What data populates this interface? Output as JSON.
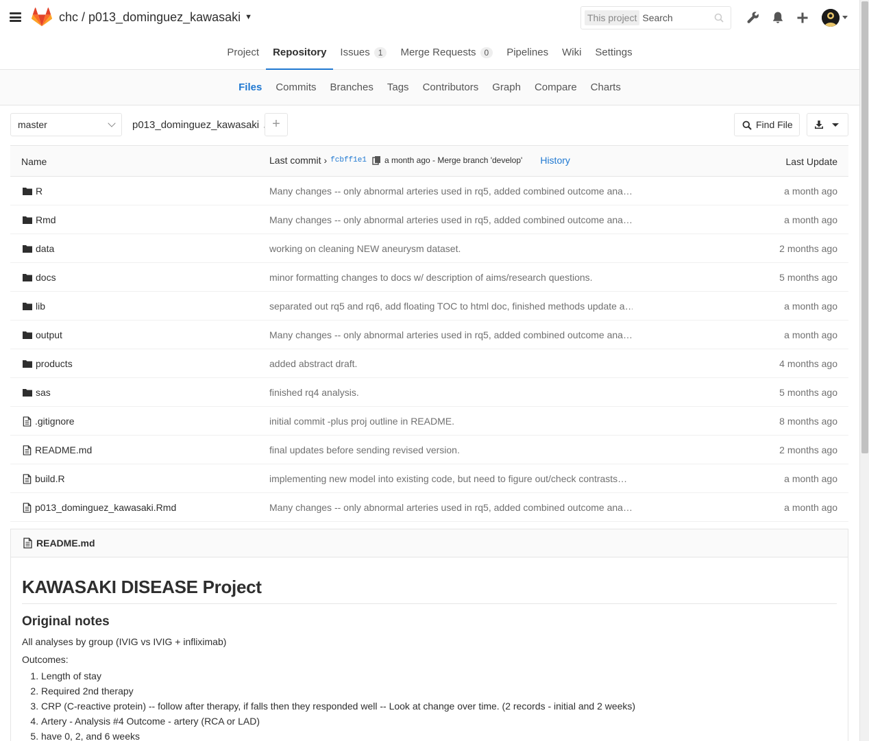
{
  "header": {
    "project_path": "chc / p013_dominguez_kawasaki",
    "search_scope": "This project",
    "search_placeholder": "Search"
  },
  "main_nav": [
    {
      "label": "Project",
      "active": false
    },
    {
      "label": "Repository",
      "active": true
    },
    {
      "label": "Issues",
      "badge": "1",
      "active": false
    },
    {
      "label": "Merge Requests",
      "badge": "0",
      "active": false
    },
    {
      "label": "Pipelines",
      "active": false
    },
    {
      "label": "Wiki",
      "active": false
    },
    {
      "label": "Settings",
      "active": false
    }
  ],
  "sub_nav": [
    {
      "label": "Files",
      "active": true
    },
    {
      "label": "Commits"
    },
    {
      "label": "Branches"
    },
    {
      "label": "Tags"
    },
    {
      "label": "Contributors"
    },
    {
      "label": "Graph"
    },
    {
      "label": "Compare"
    },
    {
      "label": "Charts"
    }
  ],
  "tree": {
    "branch": "master",
    "breadcrumb": "p013_dominguez_kawasaki",
    "breadcrumb_sep": "/",
    "add_label": "+",
    "find_file": "Find File"
  },
  "table": {
    "col_name": "Name",
    "last_commit_label": "Last commit",
    "last_commit_arrow": "›",
    "last_commit_sha": "fcbff1e1",
    "last_commit_msg": "a month ago - Merge branch 'develop'",
    "history": "History",
    "col_update": "Last Update",
    "rows": [
      {
        "name": "R",
        "type": "folder",
        "message": "Many changes -- only abnormal arteries used in rq5, added combined outcome ana…",
        "date": "a month ago"
      },
      {
        "name": "Rmd",
        "type": "folder",
        "message": "Many changes -- only abnormal arteries used in rq5, added combined outcome ana…",
        "date": "a month ago"
      },
      {
        "name": "data",
        "type": "folder",
        "message": "working on cleaning NEW aneurysm dataset.",
        "date": "2 months ago"
      },
      {
        "name": "docs",
        "type": "folder",
        "message": "minor formatting changes to docs w/ description of aims/research questions.",
        "date": "5 months ago"
      },
      {
        "name": "lib",
        "type": "folder",
        "message": "separated out rq5 and rq6, add floating TOC to html doc, finished methods update a…",
        "date": "a month ago"
      },
      {
        "name": "output",
        "type": "folder",
        "message": "Many changes -- only abnormal arteries used in rq5, added combined outcome ana…",
        "date": "a month ago"
      },
      {
        "name": "products",
        "type": "folder",
        "message": "added abstract draft.",
        "date": "4 months ago"
      },
      {
        "name": "sas",
        "type": "folder",
        "message": "finished rq4 analysis.",
        "date": "5 months ago"
      },
      {
        "name": ".gitignore",
        "type": "file",
        "message": "initial commit -plus proj outline in README.",
        "date": "8 months ago"
      },
      {
        "name": "README.md",
        "type": "file",
        "message": "final updates before sending revised version.",
        "date": "2 months ago"
      },
      {
        "name": "build.R",
        "type": "file",
        "message": "implementing new model into existing code, but need to figure out/check contrasts…",
        "date": "a month ago"
      },
      {
        "name": "p013_dominguez_kawasaki.Rmd",
        "type": "file",
        "message": "Many changes -- only abnormal arteries used in rq5, added combined outcome ana…",
        "date": "a month ago"
      }
    ]
  },
  "readme": {
    "filename": "README.md",
    "h1": "KAWASAKI DISEASE Project",
    "h2": "Original notes",
    "p1": "All analyses by group (IVIG vs IVIG + infliximab)",
    "p2": "Outcomes:",
    "items": [
      "Length of stay",
      "Required 2nd therapy",
      "CRP (C-reactive protein) -- follow after therapy, if falls then they responded well -- Look at change over time. (2 records - initial and 2 weeks)",
      "Artery - Analysis #4 Outcome - artery (RCA or LAD)",
      "have 0, 2, and 6 weeks"
    ]
  },
  "colors": {
    "accent": "#1f78d1",
    "logo_orange": "#e24329",
    "logo_light": "#fca326",
    "logo_mid": "#fc6d26"
  }
}
